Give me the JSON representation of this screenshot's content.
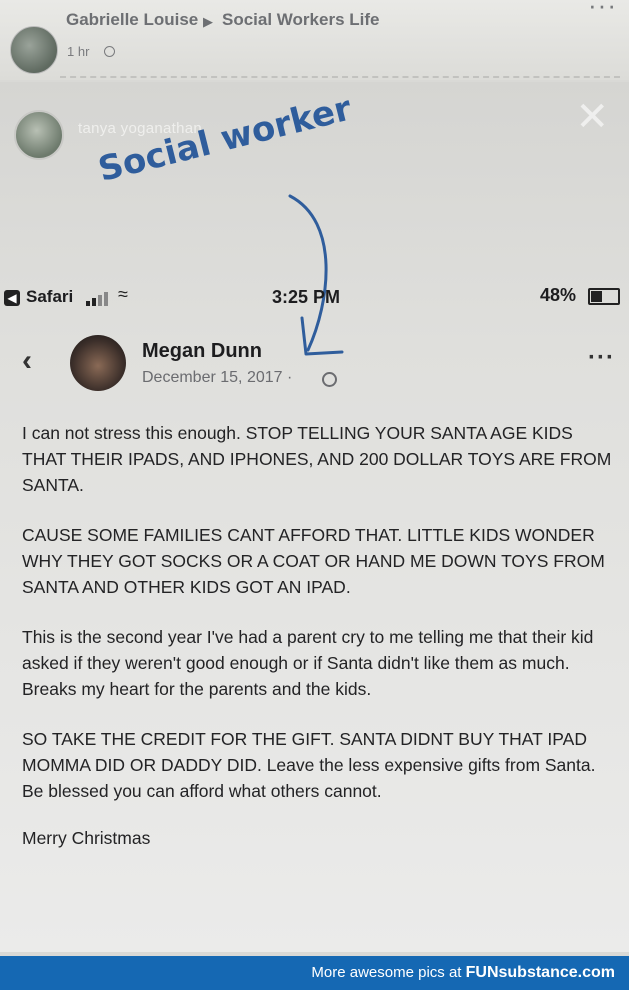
{
  "outer_post": {
    "author": "Gabrielle Louise",
    "group": "Social Workers Life",
    "time": "1 hr"
  },
  "story": {
    "username": "tanya yoganathan",
    "annotation": "Social worker"
  },
  "status_bar": {
    "app": "Safari",
    "time": "3:25 PM",
    "battery": "48%"
  },
  "post": {
    "author": "Megan Dunn",
    "date": "December 15, 2017 ·",
    "paragraphs": [
      "I can not stress this enough. STOP TELLING YOUR SANTA AGE KIDS THAT THEIR IPADS, AND IPHONES, AND 200 DOLLAR TOYS ARE FROM SANTA.",
      "CAUSE SOME FAMILIES CANT AFFORD THAT. LITTLE KIDS WONDER WHY THEY GOT SOCKS OR A COAT OR HAND ME DOWN TOYS FROM SANTA AND OTHER KIDS GOT AN IPAD.",
      "This is the second year I've had a parent cry to me telling me that their kid asked if they weren't good enough or if Santa didn't like them as much.  Breaks my heart for the parents and the kids.",
      "SO TAKE THE CREDIT FOR THE GIFT. SANTA DIDNT BUY THAT IPAD MOMMA DID OR DADDY DID. Leave the less expensive gifts from Santa. Be blessed you can afford what others cannot."
    ],
    "signoff": "Merry Christmas"
  },
  "footer": {
    "text": "More awesome pics at ",
    "brand": "FUNsubstance.com"
  },
  "colors": {
    "handwriting": "#2f5d9c",
    "footer_bg": "#1568b3"
  }
}
